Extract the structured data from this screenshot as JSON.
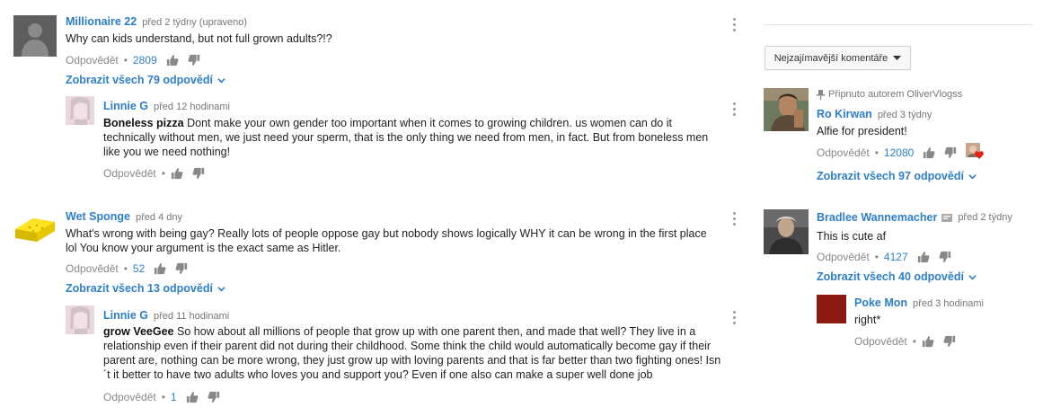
{
  "comments": [
    {
      "author": "Millionaire 22",
      "time": "před 2 týdny (upraveno)",
      "text": "Why can kids understand, but not full grown adults?!?",
      "reply_label": "Odpovědět",
      "likes": "2809",
      "view_replies": "Zobrazit všech 79 odpovědí",
      "reply": {
        "author": "Linnie G",
        "time": "před 12 hodinami",
        "mention": "Boneless pizza",
        "text": " Dont make your own gender too important when it comes to growing children. us women can do it technically without men, we just need your sperm, that is the only thing we need from men, in fact. But from boneless men like you we need nothing!",
        "reply_label": "Odpovědět"
      }
    },
    {
      "author": "Wet Sponge",
      "time": "před 4 dny",
      "text": "What's wrong with being gay? Really lots of people oppose gay but nobody shows logically WHY it can be wrong in the first place lol You know your argument is the exact same as Hitler.",
      "reply_label": "Odpovědět",
      "likes": "52",
      "view_replies": "Zobrazit všech 13 odpovědí",
      "reply": {
        "author": "Linnie G",
        "time": "před 11 hodinami",
        "mention": "grow VeeGee",
        "text": " So how about all millions of people that grow up with one parent then, and made that well? They live in a relationship even if their parent did not during their childhood. Some think the child would automatically become gay if their parent are, nothing can be more wrong, they just grow up with loving parents and that is far better than two fighting ones! Isn´t it better to have two adults who loves you and support you? Even if one also can make a super well done job",
        "reply_label": "Odpovědět",
        "likes": "1"
      }
    }
  ],
  "sidebar": {
    "sort_label": "Nejzajímavější komentáře",
    "pinned_label": "Připnuto autorem OliverVlogss",
    "comments": [
      {
        "author": "Ro Kirwan",
        "time": "před 3 týdny",
        "text": "Alfie for president!",
        "reply_label": "Odpovědět",
        "likes": "12080",
        "view_replies": "Zobrazit všech 97 odpovědí"
      },
      {
        "author": "Bradlee Wannemacher",
        "time": "před 2 týdny",
        "text": "This is cute af",
        "reply_label": "Odpovědět",
        "likes": "4127",
        "view_replies": "Zobrazit všech 40 odpovědí",
        "reply": {
          "author": "Poke Mon",
          "time": "před 3 hodinami",
          "text": "right*",
          "reply_label": "Odpovědět"
        }
      }
    ]
  },
  "icons": {
    "like": "thumb-up-icon",
    "dislike": "thumb-down-icon",
    "more": "more-vert-icon",
    "expand": "chevron-down-icon",
    "pin": "pin-icon",
    "sort": "caret-down-icon",
    "heart": "heart-icon",
    "verified": "badge-icon"
  },
  "colors": {
    "link": "#2e7ec7",
    "muted": "#888888",
    "heart": "#e62117"
  }
}
